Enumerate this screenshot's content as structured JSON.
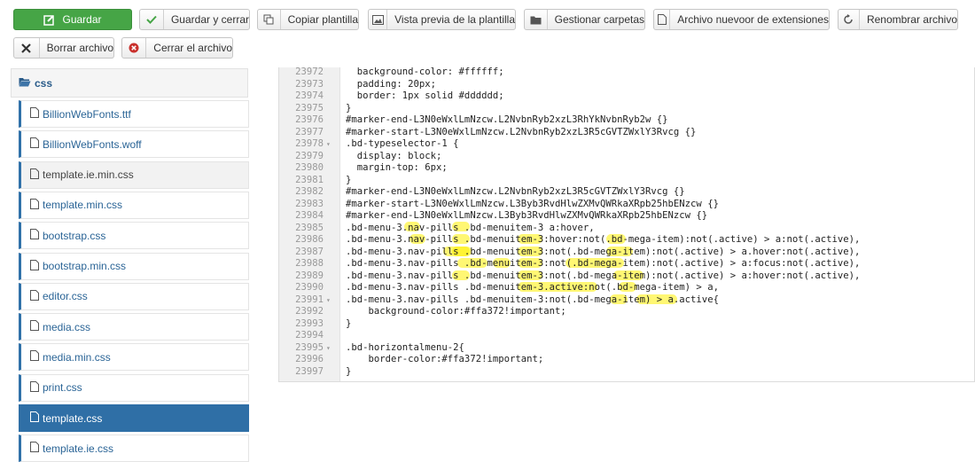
{
  "toolbar": {
    "save": "Guardar",
    "save_close": "Guardar y cerrar",
    "copy_template": "Copiar plantilla",
    "preview": "Vista previa de la plantilla",
    "manage_folders": "Gestionar carpetas",
    "new_file": "Archivo nuevoor de extensiones",
    "rename_file": "Renombrar archivo",
    "delete_file": "Borrar archivo",
    "close_file": "Cerrar el archivo"
  },
  "sidebar": {
    "folder": "css",
    "files": [
      "BillionWebFonts.ttf",
      "BillionWebFonts.woff",
      "template.ie.min.css",
      "template.min.css",
      "bootstrap.css",
      "bootstrap.min.css",
      "editor.css",
      "media.css",
      "media.min.css",
      "print.css",
      "template.css",
      "template.ie.css"
    ],
    "active_file": "template.css",
    "hover_file": "template.ie.min.css"
  },
  "editor": {
    "lines": [
      {
        "n": "23972",
        "f": "",
        "t": "  background-color: #ffffff;"
      },
      {
        "n": "23973",
        "f": "",
        "t": "  padding: 20px;"
      },
      {
        "n": "23974",
        "f": "",
        "t": "  border: 1px solid #dddddd;"
      },
      {
        "n": "23975",
        "f": "",
        "t": "}"
      },
      {
        "n": "23976",
        "f": "",
        "t": "#marker-end-L3N0eWxlLmNzcw.L2NvbnRyb2xzL3RhYkNvbnRyb2w {}"
      },
      {
        "n": "23977",
        "f": "",
        "t": "#marker-start-L3N0eWxlLmNzcw.L2NvbnRyb2xzL3R5cGVTZWxlY3Rvcg {}"
      },
      {
        "n": "23978",
        "f": "▾",
        "t": ".bd-typeselector-1 {"
      },
      {
        "n": "23979",
        "f": "",
        "t": "  display: block;"
      },
      {
        "n": "23980",
        "f": "",
        "t": "  margin-top: 6px;"
      },
      {
        "n": "23981",
        "f": "",
        "t": "}"
      },
      {
        "n": "23982",
        "f": "",
        "t": "#marker-end-L3N0eWxlLmNzcw.L2NvbnRyb2xzL3R5cGVTZWxlY3Rvcg {}"
      },
      {
        "n": "23983",
        "f": "",
        "t": "#marker-start-L3N0eWxlLmNzcw.L3Byb3RvdHlwZXMvQWRkaXRpb25hbENzcw {}"
      },
      {
        "n": "23984",
        "f": "",
        "t": "#marker-end-L3N0eWxlLmNzcw.L3Byb3RvdHlwZXMvQWRkaXRpb25hbENzcw {}"
      },
      {
        "n": "23985",
        "f": "",
        "t": ".bd-menu-3.nav-pills .bd-menuitem-3 a:hover,"
      },
      {
        "n": "23986",
        "f": "",
        "t": ".bd-menu-3.nav-pills .bd-menuitem-3:hover:not(.bd-mega-item):not(.active) > a:not(.active),"
      },
      {
        "n": "23987",
        "f": "",
        "t": ".bd-menu-3.nav-pills .bd-menuitem-3:not(.bd-mega-item):not(.active) > a.hover:not(.active),"
      },
      {
        "n": "23988",
        "f": "",
        "t": ".bd-menu-3.nav-pills .bd-menuitem-3:not(.bd-mega-item):not(.active) > a:focus:not(.active),"
      },
      {
        "n": "23989",
        "f": "",
        "t": ".bd-menu-3.nav-pills .bd-menuitem-3:not(.bd-mega-item):not(.active) > a:hover:not(.active),"
      },
      {
        "n": "23990",
        "f": "",
        "t": ".bd-menu-3.nav-pills .bd-menuitem-3.active:not(.bd-mega-item) > a,"
      },
      {
        "n": "23991",
        "f": "▾",
        "t": ".bd-menu-3.nav-pills .bd-menuitem-3:not(.bd-mega-item) > a.active{"
      },
      {
        "n": "23992",
        "f": "",
        "t": "    background-color:#ffa372!important;"
      },
      {
        "n": "23993",
        "f": "",
        "t": "}"
      },
      {
        "n": "23994",
        "f": "",
        "t": ""
      },
      {
        "n": "23995",
        "f": "▾",
        "t": ".bd-horizontalmenu-2{"
      },
      {
        "n": "23996",
        "f": "",
        "t": "    border-color:#ffa372!important;"
      },
      {
        "n": "23997",
        "f": "",
        "t": "}"
      }
    ]
  },
  "colors": {
    "save_green": "#46a546",
    "active_blue": "#2f6fa6",
    "highlight": "#fff000"
  }
}
